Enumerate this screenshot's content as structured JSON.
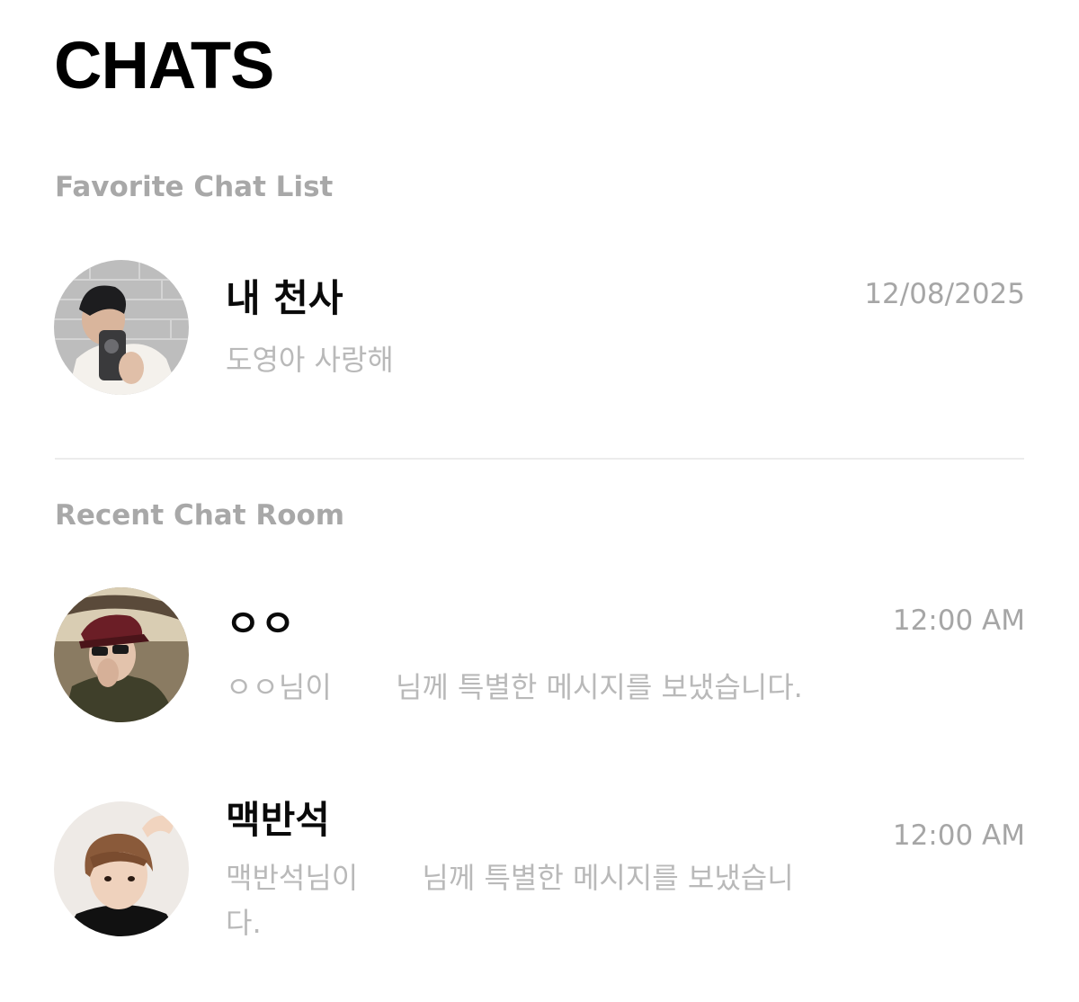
{
  "header": {
    "title": "CHATS"
  },
  "favorites": {
    "label": "Favorite Chat List",
    "items": [
      {
        "name": "내 천사",
        "preview": "도영아 사랑해",
        "time": "12/08/2025"
      }
    ]
  },
  "recent": {
    "label": "Recent Chat Room",
    "items": [
      {
        "name": "ㅇㅇ",
        "preview": "ㅇㅇ님이       님께 특별한 메시지를 보냈습니다.",
        "time": "12:00 AM"
      },
      {
        "name": "맥반석",
        "preview": "맥반석님이       님께 특별한 메시지를 보냈습니\n다.",
        "time": "12:00 AM"
      }
    ]
  }
}
